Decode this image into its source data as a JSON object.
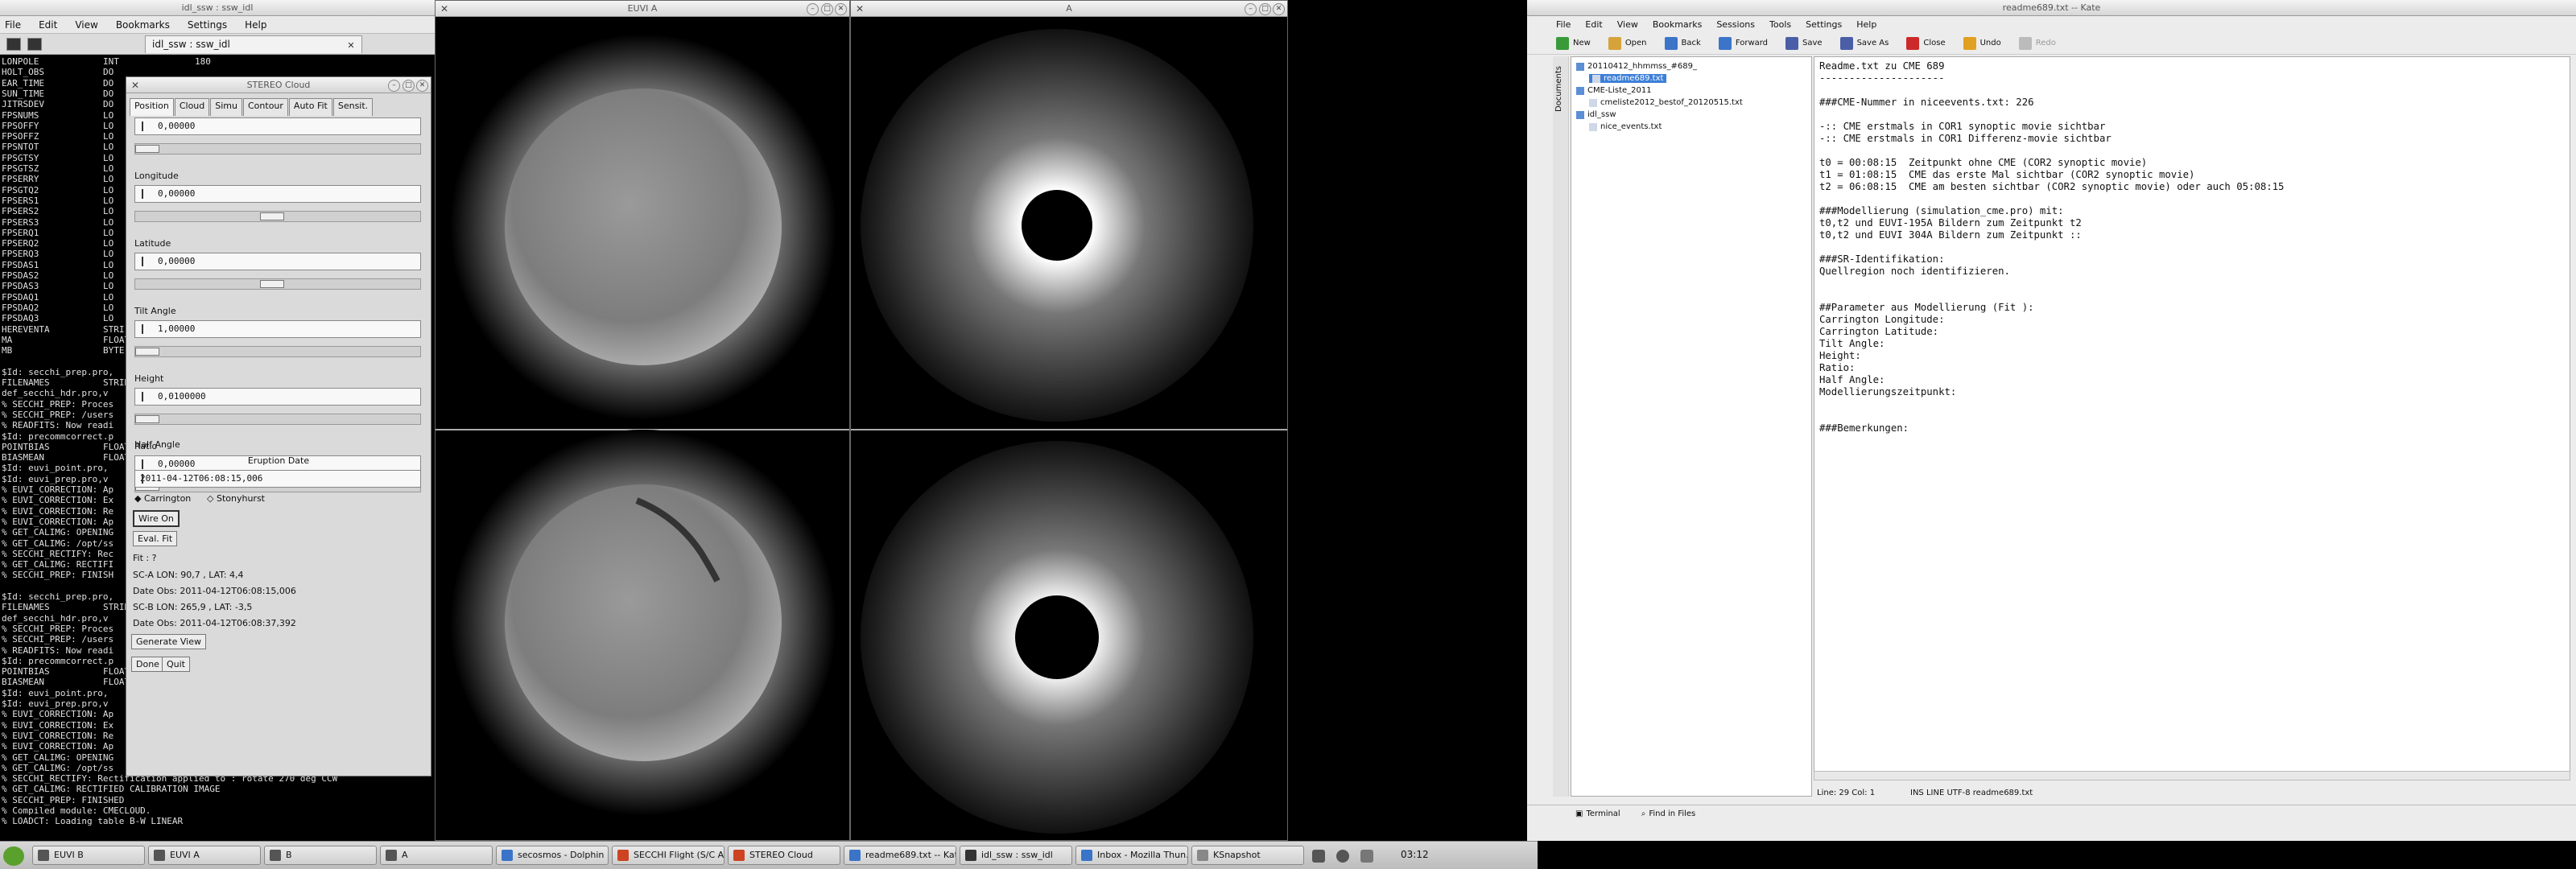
{
  "konsole": {
    "window_title": "idl_ssw : ssw_idl",
    "menu": [
      "File",
      "Edit",
      "View",
      "Bookmarks",
      "Settings",
      "Help"
    ],
    "tab_label": "idl_ssw : ssw_idl",
    "lines": [
      {
        "n": "LONPOLE",
        "v": "INT",
        "b": "180"
      },
      {
        "n": "HOLT_OBS",
        "v": "DO",
        "b": ""
      },
      {
        "n": "EAR_TIME",
        "v": "DO",
        "b": ""
      },
      {
        "n": "SUN_TIME",
        "v": "DO",
        "b": ""
      },
      {
        "n": "JITRSDEV",
        "v": "DO",
        "b": ""
      },
      {
        "n": "FPSNUMS",
        "v": "LO",
        "b": ""
      },
      {
        "n": "FPSOFFY",
        "v": "LO",
        "b": ""
      },
      {
        "n": "FPSOFFZ",
        "v": "LO",
        "b": ""
      },
      {
        "n": "FPSNTOT",
        "v": "LO",
        "b": ""
      },
      {
        "n": "FPSGTSY",
        "v": "LO",
        "b": ""
      },
      {
        "n": "FPSGTSZ",
        "v": "LO",
        "b": ""
      },
      {
        "n": "FPSERRY",
        "v": "LO",
        "b": ""
      },
      {
        "n": "FPSGTQ2",
        "v": "LO",
        "b": ""
      },
      {
        "n": "FPSERS1",
        "v": "LO",
        "b": ""
      },
      {
        "n": "FPSERS2",
        "v": "LO",
        "b": ""
      },
      {
        "n": "FPSERS3",
        "v": "LO",
        "b": ""
      },
      {
        "n": "FPSERQ1",
        "v": "LO",
        "b": ""
      },
      {
        "n": "FPSERQ2",
        "v": "LO",
        "b": ""
      },
      {
        "n": "FPSERQ3",
        "v": "LO",
        "b": ""
      },
      {
        "n": "FPSDAS1",
        "v": "LO",
        "b": ""
      },
      {
        "n": "FPSDAS2",
        "v": "LO",
        "b": ""
      },
      {
        "n": "FPSDAS3",
        "v": "LO",
        "b": ""
      },
      {
        "n": "FPSDAQ1",
        "v": "LO",
        "b": ""
      },
      {
        "n": "FPSDAQ2",
        "v": "LO",
        "b": ""
      },
      {
        "n": "FPSDAQ3",
        "v": "LO",
        "b": ""
      },
      {
        "n": "HEREVENTA",
        "v": "STRI",
        "b": ""
      },
      {
        "n": "MA",
        "v": "FLOAT",
        "b": ""
      },
      {
        "n": "MB",
        "v": "BYTE",
        "b": ""
      },
      {
        "n": "",
        "v": "",
        "b": ""
      },
      {
        "n": "$Id: secchi_prep.pro,",
        "v": "",
        "b": ""
      },
      {
        "n": "FILENAMES",
        "v": "STRING",
        "b": ""
      },
      {
        "n": "def_secchi_hdr.pro,v",
        "v": "",
        "b": ""
      },
      {
        "n": "% SECCHI_PREP: Proces",
        "v": "",
        "b": ""
      },
      {
        "n": "% SECCHI_PREP: /users",
        "v": "",
        "b": ""
      },
      {
        "n": "% READFITS: Now readi",
        "v": "",
        "b": ""
      },
      {
        "n": "$Id: precommcorrect.p",
        "v": "",
        "b": ""
      },
      {
        "n": "POINTBIAS",
        "v": "FLOAT",
        "b": ""
      },
      {
        "n": "BIASMEAN",
        "v": "FLOAT",
        "b": ""
      },
      {
        "n": "$Id: euvi_point.pro,",
        "v": "",
        "b": ""
      },
      {
        "n": "$Id: euvi_prep.pro,v",
        "v": "",
        "b": ""
      },
      {
        "n": "% EUVI_CORRECTION: Ap",
        "v": "",
        "b": ""
      },
      {
        "n": "% EUVI_CORRECTION: Ex",
        "v": "",
        "b": ""
      },
      {
        "n": "% EUVI_CORRECTION: Re",
        "v": "",
        "b": ""
      },
      {
        "n": "% EUVI_CORRECTION: Ap",
        "v": "",
        "b": ""
      },
      {
        "n": "% GET_CALIMG: OPENING",
        "v": "",
        "b": ""
      },
      {
        "n": "% GET_CALIMG: /opt/ss",
        "v": "",
        "b": ""
      },
      {
        "n": "% SECCHI_RECTIFY: Rec",
        "v": "",
        "b": ""
      },
      {
        "n": "% GET_CALIMG: RECTIFI",
        "v": "",
        "b": ""
      },
      {
        "n": "% SECCHI_PREP: FINISH",
        "v": "",
        "b": ""
      },
      {
        "n": "",
        "v": "",
        "b": ""
      },
      {
        "n": "$Id: secchi_prep.pro,",
        "v": "",
        "b": ""
      },
      {
        "n": "FILENAMES",
        "v": "STRING",
        "b": ""
      },
      {
        "n": "def_secchi_hdr.pro,v",
        "v": "",
        "b": ""
      },
      {
        "n": "% SECCHI_PREP: Proces",
        "v": "",
        "b": ""
      },
      {
        "n": "% SECCHI_PREP: /users",
        "v": "",
        "b": ""
      },
      {
        "n": "% READFITS: Now readi",
        "v": "",
        "b": ""
      },
      {
        "n": "$Id: precommcorrect.p",
        "v": "",
        "b": ""
      },
      {
        "n": "POINTBIAS",
        "v": "FLOAT",
        "b": ""
      },
      {
        "n": "BIASMEAN",
        "v": "FLOAT",
        "b": ""
      },
      {
        "n": "$Id: euvi_point.pro,",
        "v": "",
        "b": ""
      },
      {
        "n": "$Id: euvi_prep.pro,v",
        "v": "",
        "b": ""
      },
      {
        "n": "% EUVI_CORRECTION: Ap",
        "v": "",
        "b": ""
      },
      {
        "n": "% EUVI_CORRECTION: Ex",
        "v": "",
        "b": ""
      },
      {
        "n": "% EUVI_CORRECTION: Re",
        "v": "",
        "b": ""
      },
      {
        "n": "% EUVI_CORRECTION: Ap",
        "v": "",
        "b": ""
      },
      {
        "n": "% GET_CALIMG: OPENING",
        "v": "",
        "b": ""
      },
      {
        "n": "% GET_CALIMG: /opt/ss",
        "v": "",
        "b": ""
      }
    ],
    "tail_lines": [
      "% SECCHI_RECTIFY: Rectification applied to : rotate 270 deg CCW",
      "% GET_CALIMG: RECTIFIED CALIBRATION IMAGE",
      "% SECCHI_PREP: FINISHED",
      "% Compiled module: CMECLOUD.",
      "% LOADCT: Loading table B-W LINEAR"
    ]
  },
  "stereo": {
    "title": "STEREO Cloud",
    "tabs": [
      "Position",
      "Cloud",
      "Simu",
      "Contour",
      "Auto Fit",
      "Sensit."
    ],
    "params": [
      {
        "label": "",
        "value": "0,00000",
        "thumb_frac": 0.0
      },
      {
        "label": "Longitude",
        "value": "0,00000",
        "thumb_frac": 0.48
      },
      {
        "label": "Latitude",
        "value": "0,00000",
        "thumb_frac": 0.48
      },
      {
        "label": "Tilt Angle",
        "value": "1,00000",
        "thumb_frac": 0.0
      },
      {
        "label": "Height",
        "value": "0,0100000",
        "thumb_frac": 0.0
      },
      {
        "label": "Ratio",
        "value": "0,00000",
        "thumb_frac": 0.0
      }
    ],
    "half_angle_label": "Half Angle",
    "eruption_label": "Eruption Date",
    "eruption_value": "2011-04-12T06:08:15,006",
    "radio_carrington": "Carrington",
    "radio_stonyhurst": "Stonyhurst",
    "wire_on": "Wire On",
    "eval_fit": "Eval. Fit",
    "fit": "Fit : ?",
    "sca": "SC-A LON:   90,7  , LAT:    4,4",
    "date_a": "Date Obs: 2011-04-12T06:08:15,006",
    "scb": "SC-B LON:  265,9  , LAT:   -3,5",
    "date_b": "Date Obs: 2011-04-12T06:08:37,392",
    "generate_view": "Generate View",
    "done": "Done",
    "quit": "Quit"
  },
  "euvia": {
    "title": "EUVI A"
  },
  "cor": {
    "title": "A"
  },
  "kate": {
    "window_title": "readme689.txt -- Kate",
    "menu": [
      "File",
      "Edit",
      "View",
      "Bookmarks",
      "Sessions",
      "Tools",
      "Settings",
      "Help"
    ],
    "toolbar": [
      {
        "label": "New",
        "color": "#3a9a3a",
        "disabled": false
      },
      {
        "label": "Open",
        "color": "#d6a23a",
        "disabled": false
      },
      {
        "label": "Back",
        "color": "#3c74c8",
        "disabled": false
      },
      {
        "label": "Forward",
        "color": "#3c74c8",
        "disabled": false
      },
      {
        "label": "Save",
        "color": "#4a5ea8",
        "disabled": false
      },
      {
        "label": "Save As",
        "color": "#4a5ea8",
        "disabled": false
      },
      {
        "label": "Close",
        "color": "#cc2a2a",
        "disabled": false
      },
      {
        "label": "Undo",
        "color": "#e0a020",
        "disabled": false
      },
      {
        "label": "Redo",
        "color": "#bbbbbb",
        "disabled": true
      }
    ],
    "side_label": "Documents",
    "tree": [
      {
        "label": "20110412_hhmmss_#689_",
        "level": 0,
        "sel": false
      },
      {
        "label": "readme689.txt",
        "level": 1,
        "sel": true
      },
      {
        "label": "CME-Liste_2011",
        "level": 0,
        "sel": false
      },
      {
        "label": "cmeliste2012_bestof_20120515.txt",
        "level": 1,
        "sel": false
      },
      {
        "label": "idl_ssw",
        "level": 0,
        "sel": false
      },
      {
        "label": "nice_events.txt",
        "level": 1,
        "sel": false
      }
    ],
    "editor_lines": [
      "Readme.txt zu CME 689",
      "---------------------",
      "",
      "###CME-Nummer in niceevents.txt: 226",
      "",
      "-:: CME erstmals in COR1 synoptic movie sichtbar",
      "-:: CME erstmals in COR1 Differenz-movie sichtbar",
      "",
      "t0 = 00:08:15  Zeitpunkt ohne CME (COR2 synoptic movie)",
      "t1 = 01:08:15  CME das erste Mal sichtbar (COR2 synoptic movie)",
      "t2 = 06:08:15  CME am besten sichtbar (COR2 synoptic movie) oder auch 05:08:15",
      "",
      "###Modellierung (simulation_cme.pro) mit:",
      "t0,t2 und EUVI-195A Bildern zum Zeitpunkt t2",
      "t0,t2 und EUVI 304A Bildern zum Zeitpunkt ::",
      "",
      "###SR-Identifikation:",
      "Quellregion noch identifizieren.",
      "",
      "",
      "##Parameter aus Modellierung (Fit ):",
      "Carrington Longitude:",
      "Carrington Latitude:",
      "Tilt Angle:",
      "Height:",
      "Ratio:",
      "Half Angle:",
      "Modellierungszeitpunkt:",
      "",
      "",
      "###Bemerkungen:"
    ],
    "status": "Line: 29 Col: 1",
    "status_mode": "INS  LINE  UTF-8  readme689.txt",
    "bottom_terminal": "Terminal",
    "bottom_find": "Find in Files"
  },
  "taskbar": [
    {
      "label": "EUVI B",
      "color": "#555"
    },
    {
      "label": "EUVI A",
      "color": "#555"
    },
    {
      "label": "B",
      "color": "#555"
    },
    {
      "label": "A",
      "color": "#555"
    },
    {
      "label": "secosmos - Dolphin",
      "color": "#3a74c8"
    },
    {
      "label": "SECCHI Flight (S/C A…",
      "color": "#cc4422"
    },
    {
      "label": "STEREO Cloud",
      "color": "#cc4422"
    },
    {
      "label": "readme689.txt -- Kate",
      "color": "#3a74c8"
    },
    {
      "label": "idl_ssw : ssw_idl",
      "color": "#333"
    },
    {
      "label": "Inbox - Mozilla Thun…",
      "color": "#3a74c8"
    },
    {
      "label": "KSnapshot",
      "color": "#888"
    }
  ],
  "clock": "03:12"
}
